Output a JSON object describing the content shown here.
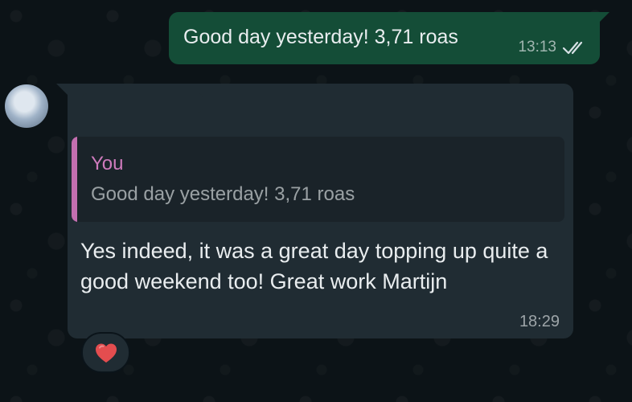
{
  "conversation": {
    "outgoing_message": {
      "text": "Good day yesterday! 3,71 roas",
      "time": "13:13",
      "status_icon": "double-check-icon"
    },
    "incoming_message": {
      "quoted_author": "You",
      "quoted_text": "Good day yesterday! 3,71 roas",
      "text": "Yes indeed, it was a great day topping up quite a good weekend too! Great work Martijn",
      "time": "18:29",
      "reaction_icon": "red-heart-icon"
    }
  },
  "colors": {
    "background": "#0b141a",
    "outgoing_bubble": "#144d37",
    "incoming_bubble": "#202c33",
    "quote_accent": "#c36fb0",
    "heart": "#e44d4f"
  }
}
